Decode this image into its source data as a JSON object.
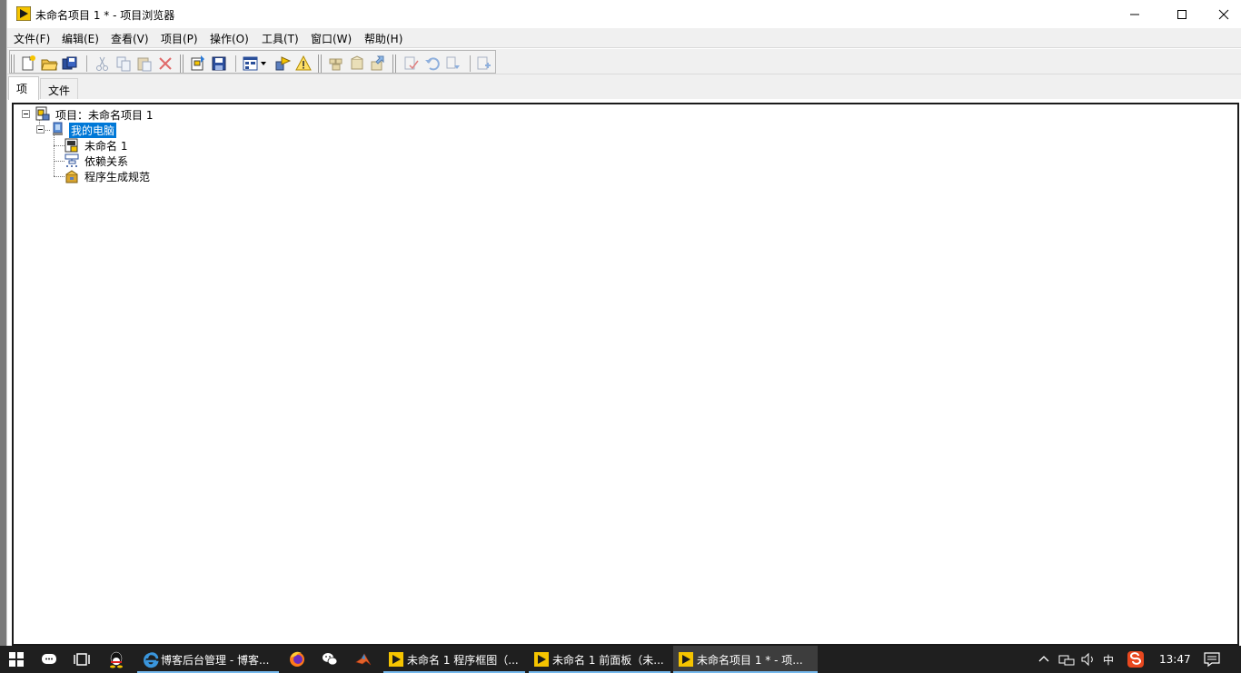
{
  "window": {
    "title": "未命名项目 1 * - 项目浏览器"
  },
  "menu": {
    "items": [
      "文件(F)",
      "编辑(E)",
      "查看(V)",
      "项目(P)",
      "操作(O)",
      "工具(T)",
      "窗口(W)",
      "帮助(H)"
    ]
  },
  "toolbar": {
    "icons": [
      "new-icon",
      "open-folder-icon",
      "save-all-icon",
      "cut-icon",
      "copy-icon",
      "paste-icon",
      "delete-icon",
      "add-file-icon",
      "save-project-icon",
      "view-icon",
      "filter-icon",
      "warning-icon",
      "build-icon",
      "clean-icon",
      "deploy-icon",
      "check-icon",
      "undo-icon",
      "redo-icon",
      "zoom-icon"
    ]
  },
  "tabs": [
    {
      "label": "项",
      "active": true
    },
    {
      "label": "文件",
      "active": false
    }
  ],
  "tree": {
    "root": "项目：未命名项目 1",
    "computer": "我的电脑",
    "children": [
      "未命名 1",
      "依赖关系",
      "程序生成规范"
    ]
  },
  "taskbar": {
    "tasks": [
      {
        "label": "博客后台管理 - 博客..."
      },
      {
        "label": "未命名 1 程序框图（..."
      },
      {
        "label": "未命名 1 前面板（未..."
      },
      {
        "label": "未命名项目 1 * - 项..."
      }
    ],
    "ime": "中",
    "time": "13:47"
  },
  "colors": {
    "selection": "#0078d7",
    "taskbar": "#1f1f1f",
    "taskbar_accent": "#76b9ed",
    "labview_yellow": "#f5c400"
  }
}
